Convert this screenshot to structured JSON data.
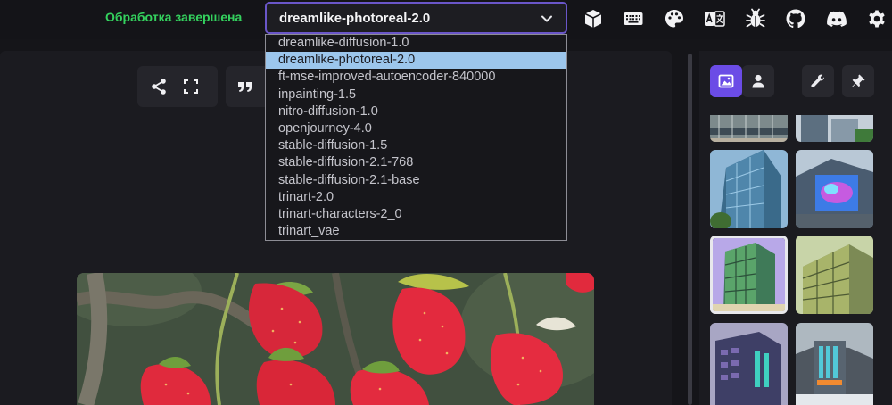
{
  "header": {
    "status": "Обработка завершена",
    "model_select": {
      "value": "dreamlike-photoreal-2.0",
      "options": [
        "dreamlike-diffusion-1.0",
        "dreamlike-photoreal-2.0",
        "ft-mse-improved-autoencoder-840000",
        "inpainting-1.5",
        "nitro-diffusion-1.0",
        "openjourney-4.0",
        "stable-diffusion-1.5",
        "stable-diffusion-2.1-768",
        "stable-diffusion-2.1-base",
        "trinart-2.0",
        "trinart-characters-2_0",
        "trinart_vae"
      ],
      "selected_index": 1
    },
    "icons": [
      "model-manager-icon",
      "keyboard-icon",
      "palette-icon",
      "translate-icon",
      "bug-icon",
      "github-icon",
      "discord-icon",
      "settings-icon"
    ]
  },
  "toolbar": {
    "icons": [
      "share-icon",
      "fullscreen-icon",
      "quote-icon"
    ]
  },
  "gallery": {
    "tabs": [
      "images-icon",
      "user-icon"
    ],
    "actions": [
      "wrench-icon",
      "pin-icon"
    ]
  },
  "colors": {
    "accent": "#6b4ce6",
    "status": "#34d25e",
    "selection": "#9cc6ec"
  }
}
